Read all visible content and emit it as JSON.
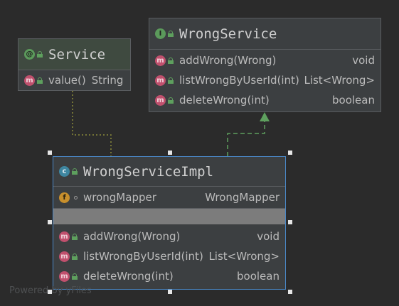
{
  "service": {
    "badge": "@",
    "title": "Service",
    "methods": [
      {
        "badge": "m",
        "label": "value()",
        "type": "String"
      }
    ]
  },
  "wrong_service": {
    "badge": "I",
    "title": "WrongService",
    "methods": [
      {
        "badge": "m",
        "label": "addWrong(Wrong)",
        "type": "void"
      },
      {
        "badge": "m",
        "label": "listWrongByUserId(int)",
        "type": "List<Wrong>"
      },
      {
        "badge": "m",
        "label": "deleteWrong(int)",
        "type": "boolean"
      }
    ]
  },
  "wrong_service_impl": {
    "badge": "c",
    "title": "WrongServiceImpl",
    "fields": [
      {
        "badge": "f",
        "label": "wrongMapper",
        "type": "WrongMapper"
      }
    ],
    "methods": [
      {
        "badge": "m",
        "label": "addWrong(Wrong)",
        "type": "void"
      },
      {
        "badge": "m",
        "label": "listWrongByUserId(int)",
        "type": "List<Wrong>"
      },
      {
        "badge": "m",
        "label": "deleteWrong(int)",
        "type": "boolean"
      }
    ]
  },
  "watermark": "Powered by yFiles",
  "colors": {
    "background": "#2b2b2b",
    "node": "#3c3f41",
    "selection": "#4a88c7",
    "annotation_edge": "#8b8b3a",
    "implements_edge": "#5ea05e"
  }
}
